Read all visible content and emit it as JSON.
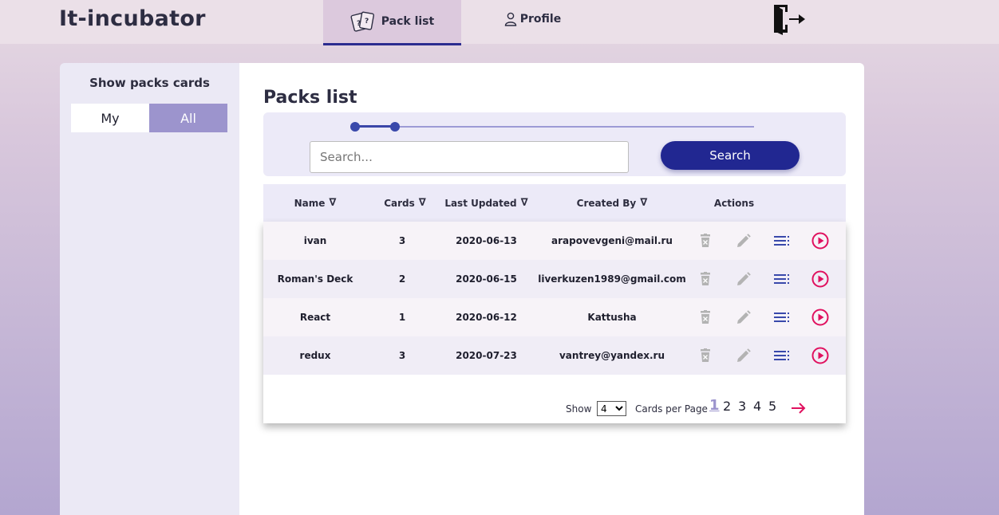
{
  "header": {
    "logo": "It-incubator",
    "tabs": [
      {
        "label": "Pack list",
        "icon": "cards-icon",
        "active": true
      },
      {
        "label": "Profile",
        "icon": "user-icon",
        "active": false
      }
    ],
    "logout_icon": "logout-icon"
  },
  "sidebar": {
    "title": "Show packs cards",
    "toggle": {
      "my": "My",
      "all": "All",
      "selected": "All"
    }
  },
  "main": {
    "title": "Packs list",
    "search": {
      "placeholder": "Search...",
      "value": "",
      "button": "Search"
    },
    "range": {
      "min": 0,
      "max": 100,
      "value": [
        0,
        10
      ]
    },
    "columns": {
      "name": "Name",
      "cards": "Cards",
      "updated": "Last Updated",
      "created_by": "Created By",
      "actions": "Actions",
      "sort_glyph": "∇"
    },
    "rows": [
      {
        "name": "ivan",
        "cards": "3",
        "updated": "2020-06-13",
        "created_by": "arapovevgeni@mail.ru"
      },
      {
        "name": "Roman's Deck",
        "cards": "2",
        "updated": "2020-06-15",
        "created_by": "liverkuzen1989@gmail.com"
      },
      {
        "name": "React",
        "cards": "1",
        "updated": "2020-06-12",
        "created_by": "Kattusha"
      },
      {
        "name": "redux",
        "cards": "3",
        "updated": "2020-07-23",
        "created_by": "vantrey@yandex.ru"
      }
    ],
    "pagination": {
      "show_label": "Show",
      "per_page_value": "4",
      "per_page_options": [
        "4"
      ],
      "per_page_label": "Cards per Page",
      "pages": [
        "1",
        "2",
        "3",
        "4",
        "5"
      ],
      "current": "1"
    }
  },
  "colors": {
    "accent": "#212791",
    "toggle_active": "#9c94cd",
    "delete": "#b3b3b3",
    "edit": "#b3b3b3",
    "list": "#3949ab",
    "play": "#e0115f"
  }
}
